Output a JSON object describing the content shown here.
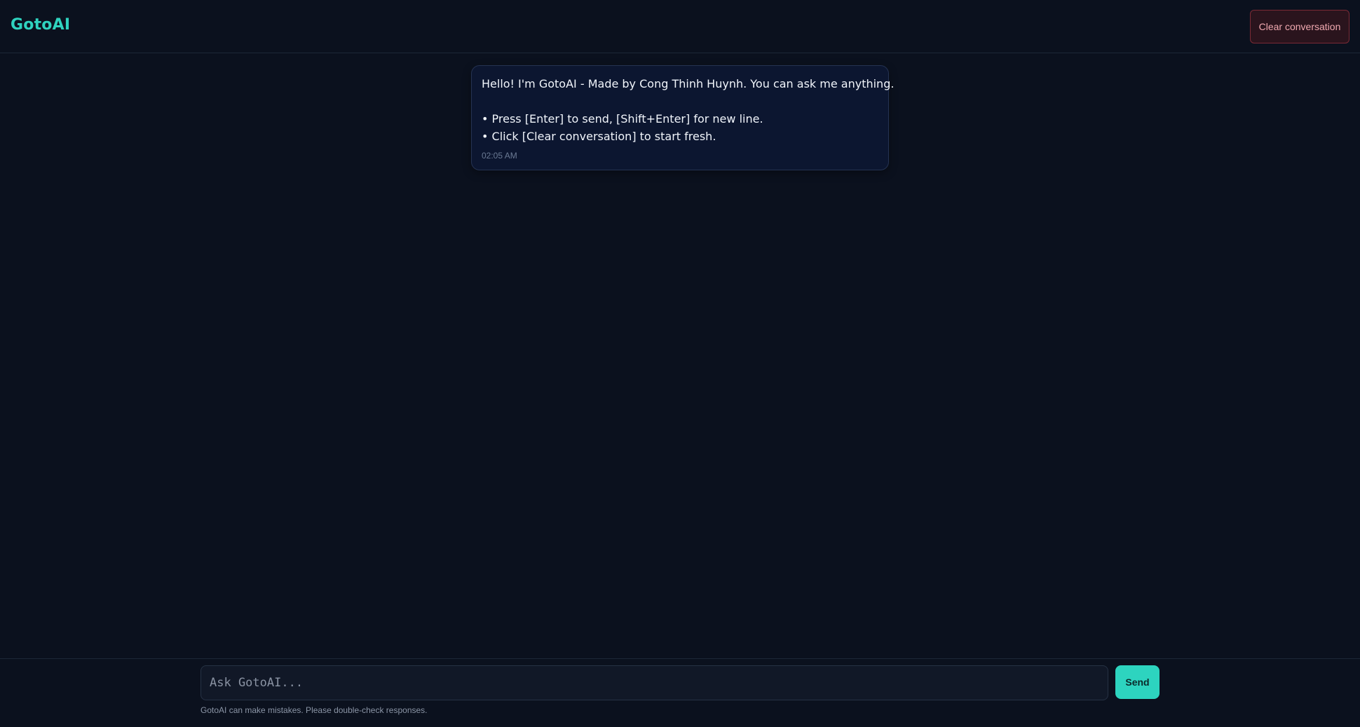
{
  "header": {
    "brand": "GotoAI",
    "clear_label": "Clear conversation"
  },
  "messages": [
    {
      "role": "assistant",
      "lines": [
        "Hello! I'm GotoAI - Made by Cong Thinh Huynh. You can ask me anything.",
        "",
        "• Press [Enter] to send, [Shift+Enter] for new line.",
        "• Click [Clear conversation] to start fresh."
      ],
      "time": "02:05 AM"
    }
  ],
  "composer": {
    "placeholder": "Ask GotoAI...",
    "value": "",
    "send_label": "Send",
    "disclaimer": "GotoAI can make mistakes. Please double-check responses."
  },
  "colors": {
    "background": "#0b111e",
    "accent": "#2dd4bf",
    "danger_text": "#f0a9b0",
    "bubble_bg": "#0c1630"
  }
}
